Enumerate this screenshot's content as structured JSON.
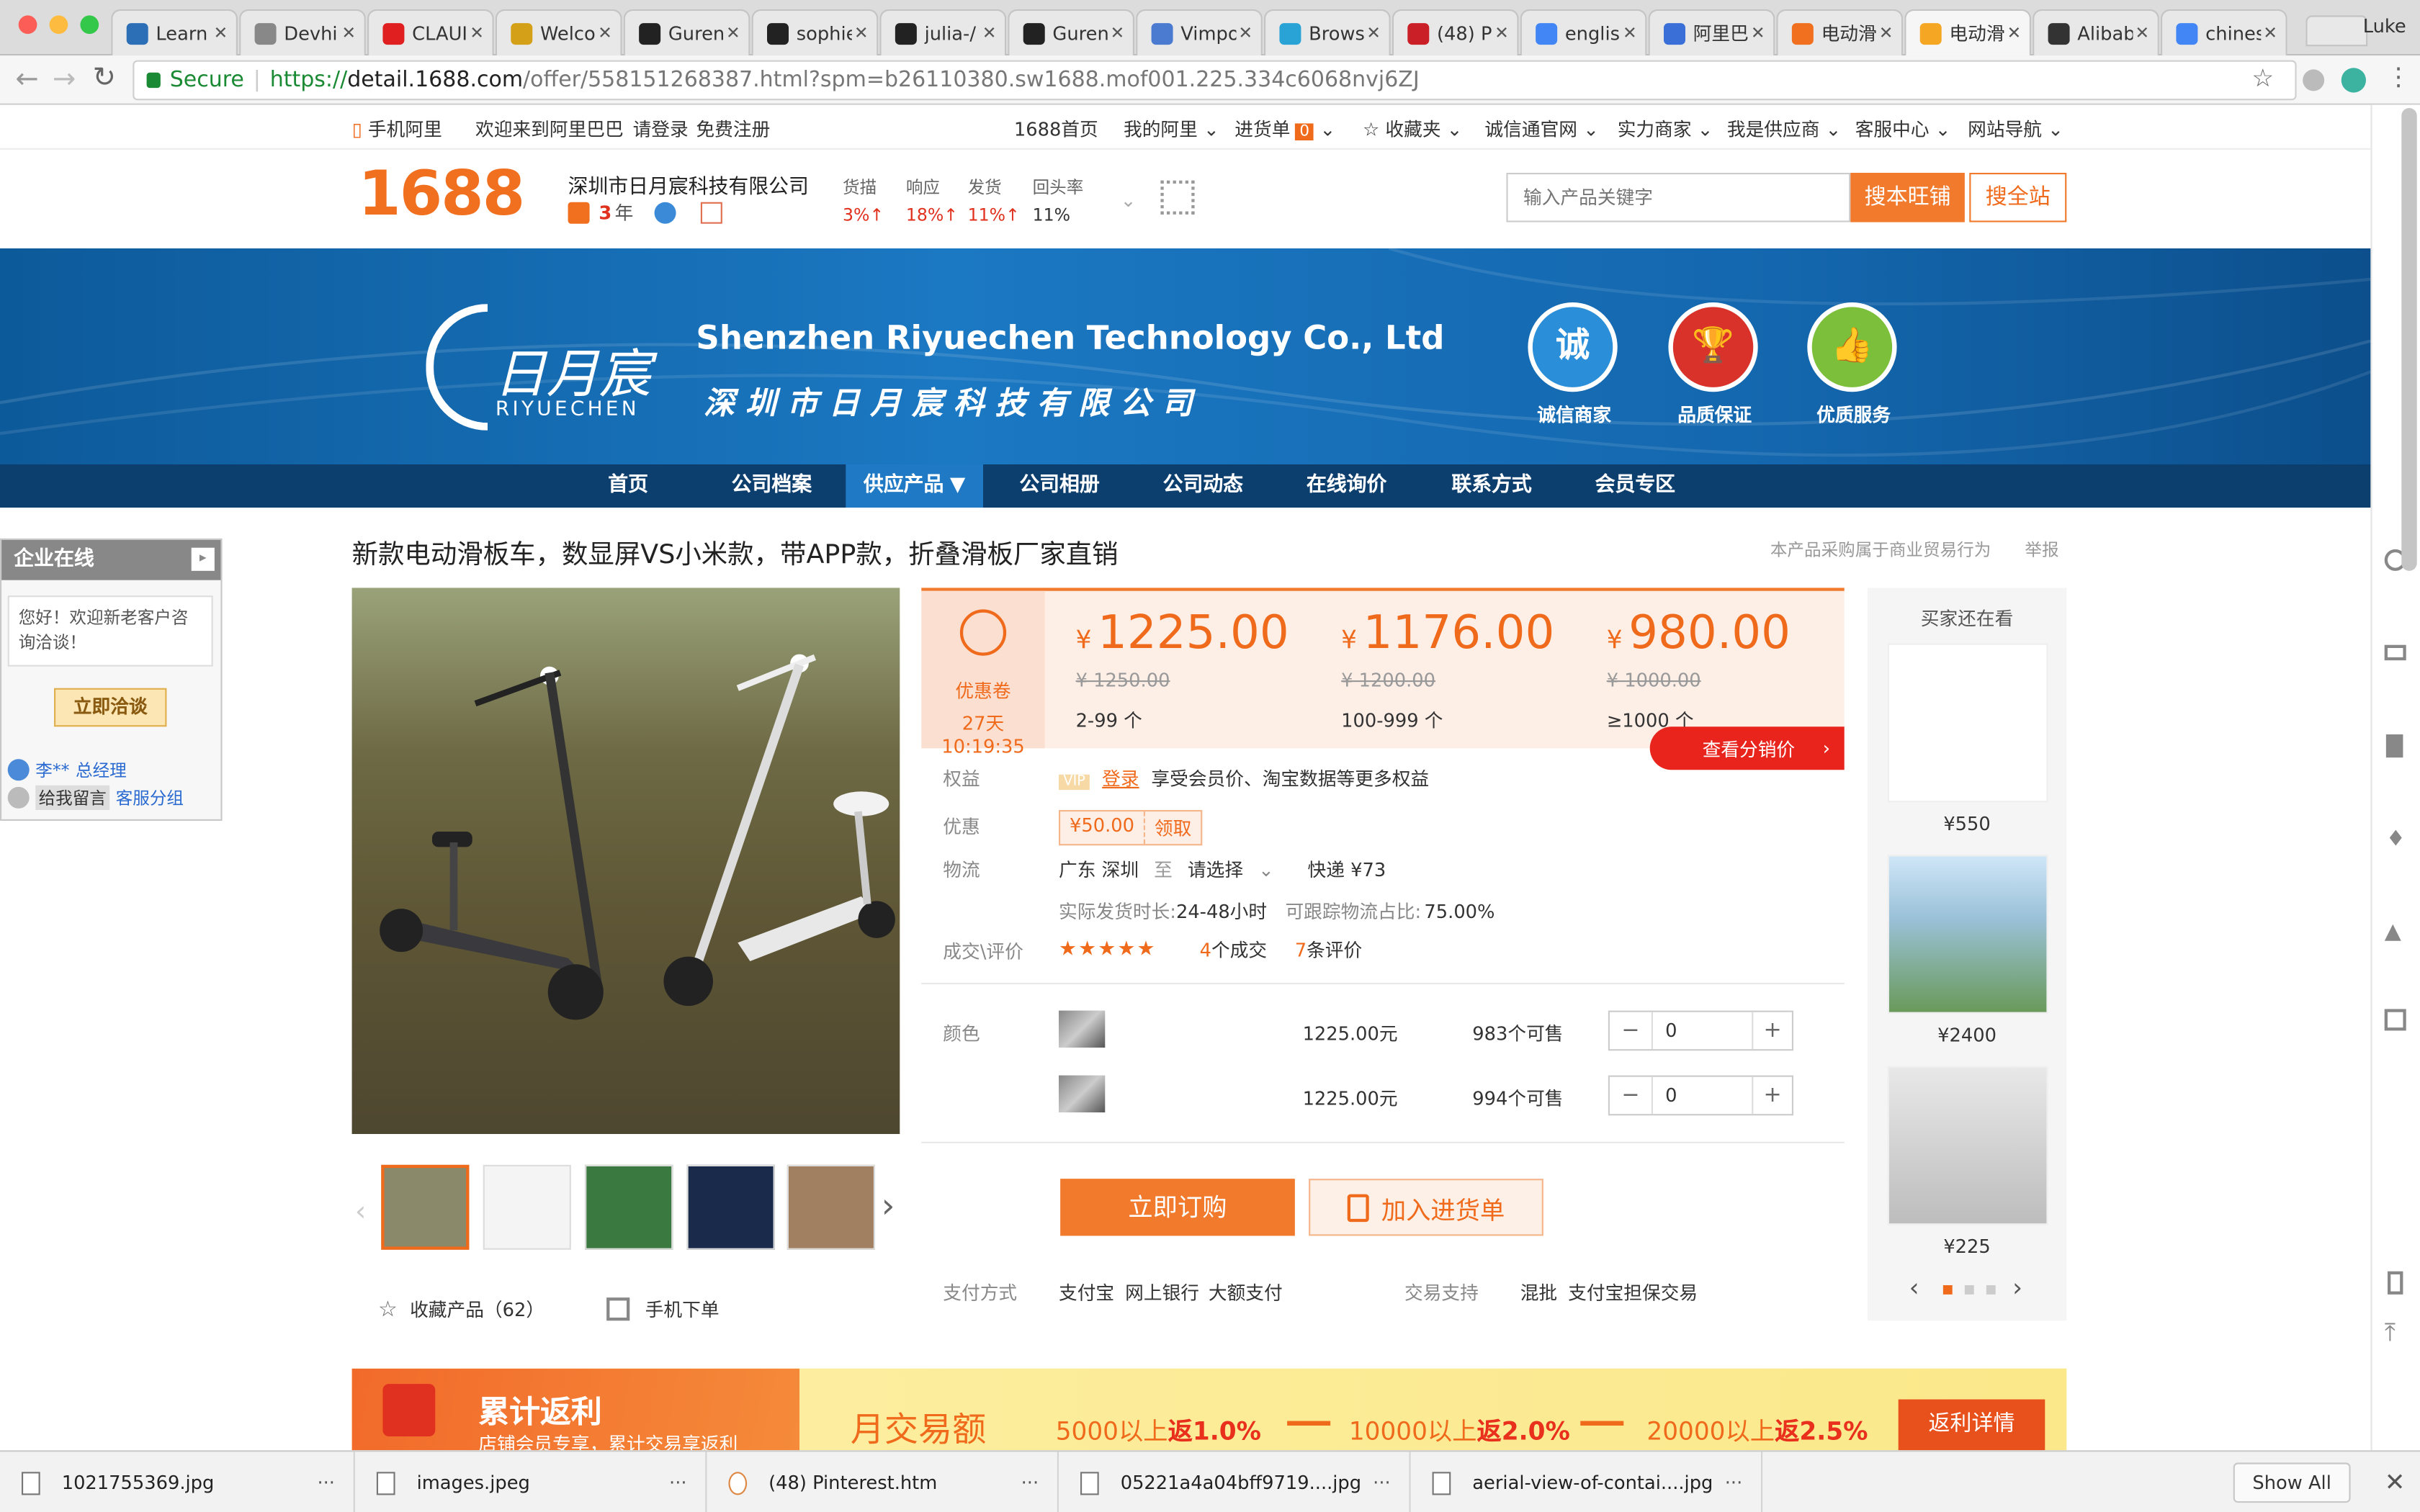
{
  "browser": {
    "user": "Luke",
    "tabs": [
      {
        "label": "Learn",
        "icon": "bar-chart-icon",
        "color": "#2c6fb7",
        "active": false
      },
      {
        "label": "Devhi",
        "icon": "document-icon",
        "color": "#888888",
        "active": false
      },
      {
        "label": "CLAUI",
        "icon": "youtube-icon",
        "color": "#e02020",
        "active": false
      },
      {
        "label": "Welco",
        "icon": "globe-icon",
        "color": "#d4a017",
        "active": false
      },
      {
        "label": "Guren",
        "icon": "github-icon",
        "color": "#222222",
        "active": false
      },
      {
        "label": "sophie",
        "icon": "github-icon",
        "color": "#222222",
        "active": false
      },
      {
        "label": "julia-/",
        "icon": "github-icon",
        "color": "#222222",
        "active": false
      },
      {
        "label": "Guren",
        "icon": "github-icon",
        "color": "#222222",
        "active": false
      },
      {
        "label": "Vimpo",
        "icon": "document-icon",
        "color": "#4a7bd0",
        "active": false
      },
      {
        "label": "Brows",
        "icon": "star-icon",
        "color": "#29a3d6",
        "active": false
      },
      {
        "label": "(48) P",
        "icon": "pinterest-icon",
        "color": "#cb1f27",
        "active": false
      },
      {
        "label": "englisl",
        "icon": "google-icon",
        "color": "#4285f4",
        "active": false
      },
      {
        "label": "阿里巴",
        "icon": "paw-icon",
        "color": "#3a6fd8",
        "active": false
      },
      {
        "label": "电动滑",
        "icon": "alibaba-icon",
        "color": "#f07020",
        "active": false
      },
      {
        "label": "电动滑",
        "icon": "alibaba-icon",
        "color": "#f5a623",
        "active": true
      },
      {
        "label": "Alibab",
        "icon": "wikipedia-icon",
        "color": "#333333",
        "active": false
      },
      {
        "label": "chines",
        "icon": "google-icon",
        "color": "#4285f4",
        "active": false
      }
    ],
    "secure_label": "Secure",
    "url_prefix": "https://",
    "url_domain": "detail.1688.com",
    "url_path": "/offer/558151268387.html?spm=b26110380.sw1688.mof001.225.334c6068nvj6ZJ"
  },
  "topbar": {
    "mobile": "手机阿里",
    "welcome": "欢迎来到阿里巴巴",
    "login": "请登录",
    "register": "免费注册",
    "home": "1688首页",
    "my_ali": "我的阿里",
    "cart": "进货单",
    "cart_count": "0",
    "favorites": "收藏夹",
    "trust": "诚信通官网",
    "merchants": "实力商家",
    "supplier": "我是供应商",
    "service": "客服中心",
    "sitenav": "网站导航"
  },
  "header": {
    "logo": "1688",
    "company": "深圳市日月宸科技有限公司",
    "years": "3",
    "years_unit": "年",
    "stats": [
      {
        "label": "货描",
        "value": "3%↑",
        "color": "#e0301e"
      },
      {
        "label": "响应",
        "value": "18%↑",
        "color": "#e0301e"
      },
      {
        "label": "发货",
        "value": "11%↑",
        "color": "#e0301e"
      },
      {
        "label": "回头率",
        "value": "11%",
        "color": "#333333"
      }
    ],
    "search_placeholder": "输入产品关键字",
    "search_shop": "搜本旺铺",
    "search_all": "搜全站"
  },
  "banner": {
    "brand_cn": "日月宸",
    "brand_en": "RIYUECHEN",
    "title_en": "Shenzhen Riyuechen Technology Co., Ltd",
    "title_cn": "深 圳 市 日 月 宸 科 技 有 限 公 司",
    "badges": [
      {
        "glyph": "诚",
        "label": "诚信商家",
        "color": "#2a8fd8"
      },
      {
        "glyph": "🏆",
        "label": "品质保证",
        "color": "#d8322a"
      },
      {
        "glyph": "👍",
        "label": "优质服务",
        "color": "#7cbf3a"
      }
    ]
  },
  "nav": {
    "items": [
      "首页",
      "公司档案",
      "供应产品",
      "公司相册",
      "公司动态",
      "在线询价",
      "联系方式",
      "会员专区"
    ],
    "active_index": 2
  },
  "chat": {
    "title": "企业在线",
    "greeting": "您好！欢迎新老客户咨询洽谈！",
    "button": "立即洽谈",
    "contact_name": "李**",
    "contact_role": "总经理",
    "leave_msg": "给我留言",
    "service_group": "客服分组"
  },
  "product": {
    "title": "新款电动滑板车，数显屏VS小米款，带APP款，折叠滑板厂家直销",
    "note": "本产品采购属于商业贸易行为",
    "report": "举报",
    "coupon_label": "优惠卷",
    "coupon_timer": "27天10:19:35",
    "prices": [
      {
        "currency": "¥",
        "price": "1225.00",
        "old": "¥ 1250.00",
        "range": "2-99 个"
      },
      {
        "currency": "¥",
        "price": "1176.00",
        "old": "¥ 1200.00",
        "range": "100-999 个"
      },
      {
        "currency": "¥",
        "price": "980.00",
        "old": "¥ 1000.00",
        "range": "≥1000 个"
      }
    ],
    "distributor_btn": "查看分销价",
    "rights_label": "权益",
    "vip": "VIP",
    "login_link": "登录",
    "rights_text": "享受会员价、淘宝数据等更多权益",
    "discount_label": "优惠",
    "discount_value": "¥50.00",
    "discount_claim": "领取",
    "logistics_label": "物流",
    "origin": "广东 深圳",
    "to": "至",
    "dest": "请选择",
    "express": "快递 ¥73",
    "ship_time_label": "实际发货时长:",
    "ship_time": "24-48小时",
    "track_label": "可跟踪物流占比:",
    "track_value": "75.00%",
    "deals_label": "成交\\评价",
    "rating": 4.5,
    "deals_count": "4",
    "deals_unit": "个成交",
    "reviews_count": "7",
    "reviews_unit": "条评价",
    "color_label": "颜色",
    "variants": [
      {
        "price": "1225.00元",
        "stock": "983个可售",
        "qty": "0"
      },
      {
        "price": "1225.00元",
        "stock": "994个可售",
        "qty": "0"
      }
    ],
    "buy_now": "立即订购",
    "add_cart": "加入进货单",
    "payment_label": "支付方式",
    "payments": [
      "支付宝",
      "网上银行",
      "大额支付"
    ],
    "trade_label": "交易支持",
    "trades": [
      "混批",
      "支付宝担保交易"
    ],
    "favorite": "收藏产品（62）",
    "mobile_order": "手机下单"
  },
  "sidebar": {
    "title": "买家还在看",
    "items": [
      {
        "price": "¥550"
      },
      {
        "price": "¥2400"
      },
      {
        "price": "¥225"
      }
    ]
  },
  "rebate": {
    "title": "累计返利",
    "subtitle": "店铺会员专享，累计交易享返利",
    "monthly": "月交易额",
    "tiers": [
      {
        "amount": "5000以上",
        "label": "返1.0%"
      },
      {
        "amount": "10000以上",
        "label": "返2.0%"
      },
      {
        "amount": "20000以上",
        "label": "返2.5%"
      }
    ],
    "details": "返利详情"
  },
  "downloads": {
    "items": [
      "1021755369.jpg",
      "images.jpeg",
      "(48) Pinterest.htm",
      "05221a4a04bff9719....jpg",
      "aerial-view-of-contai....jpg"
    ],
    "show_all": "Show All"
  }
}
